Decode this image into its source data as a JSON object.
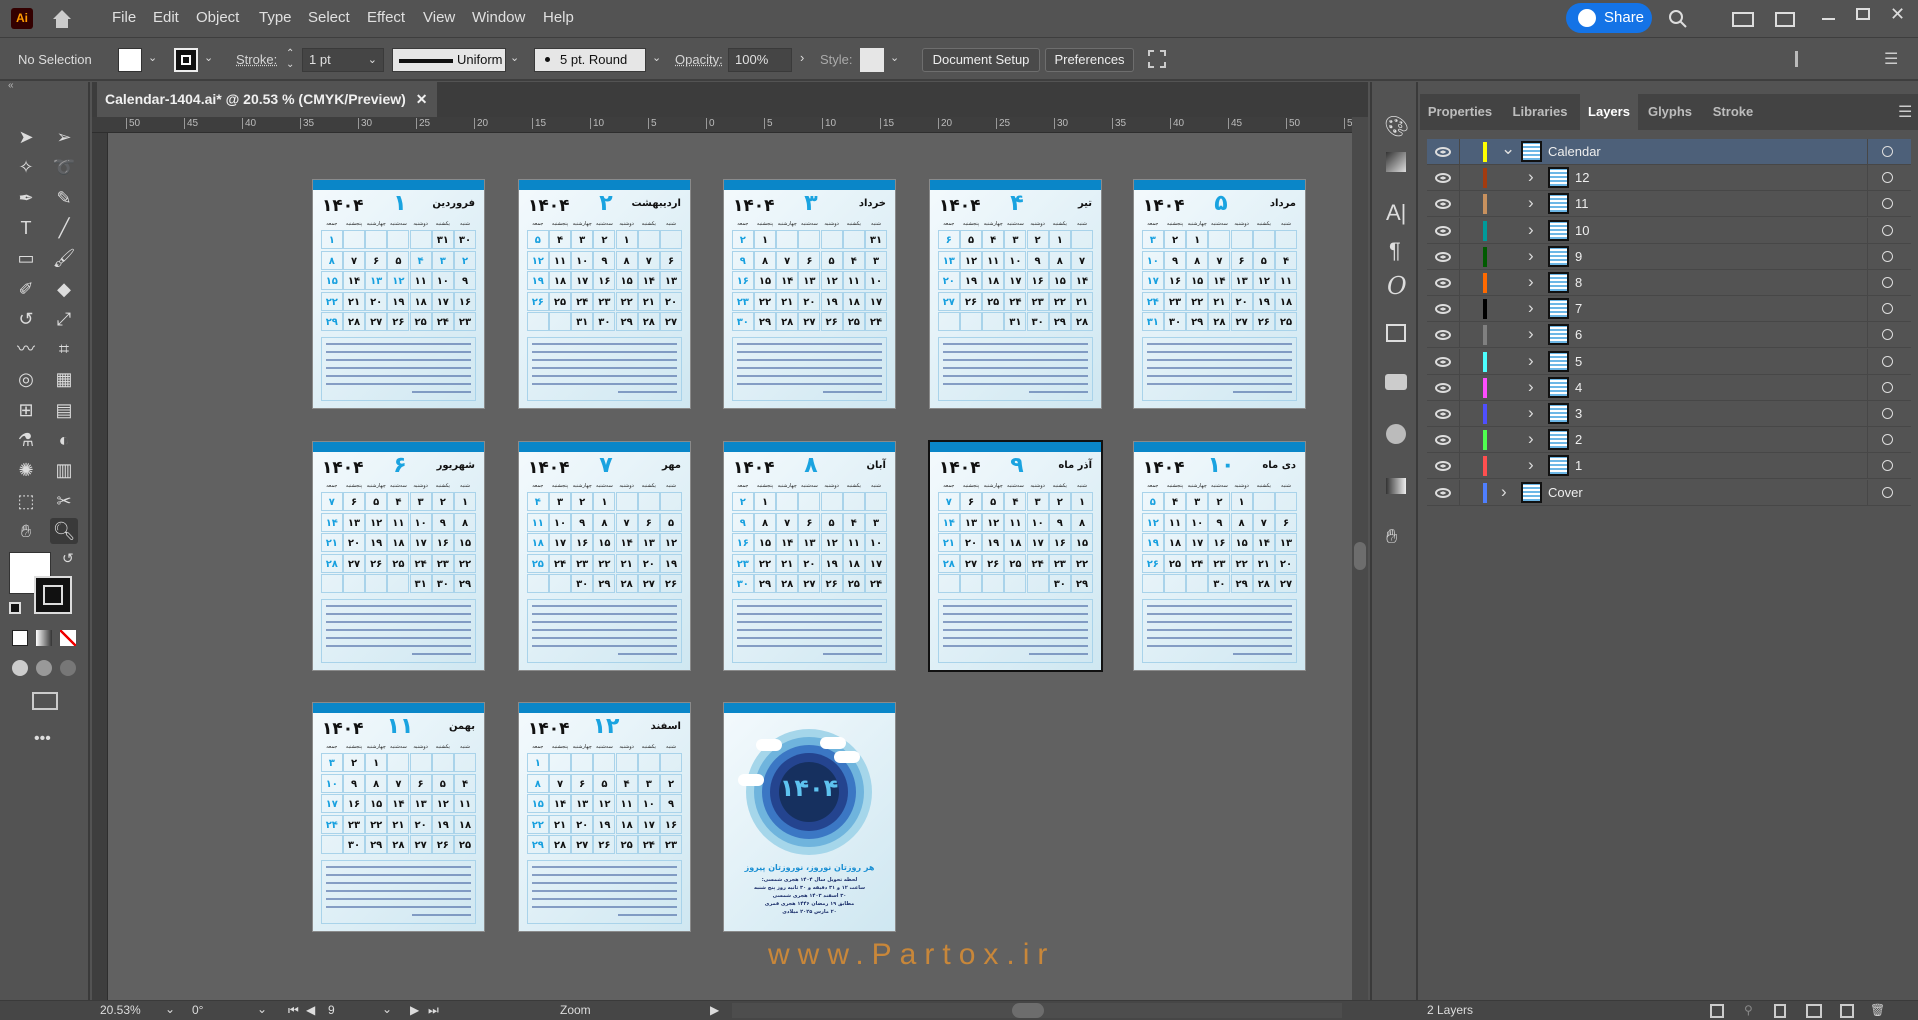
{
  "app": {
    "logo": "Ai",
    "home_icon": "home-icon"
  },
  "menu": [
    "File",
    "Edit",
    "Object",
    "Type",
    "Select",
    "Effect",
    "View",
    "Window",
    "Help"
  ],
  "share": {
    "label": "Share"
  },
  "control_bar": {
    "selection": "No Selection",
    "fill_color": "#ffffff",
    "stroke_label": "Stroke:",
    "stroke_weight": "1 pt",
    "stroke_profile": "Uniform",
    "brush": "5 pt. Round",
    "opacity_label": "Opacity:",
    "opacity": "100%",
    "style_label": "Style:",
    "document_setup": "Document Setup",
    "preferences": "Preferences"
  },
  "document_tab": {
    "title": "Calendar-1404.ai* @ 20.53 % (CMYK/Preview)",
    "close": "✕"
  },
  "ruler_ticks": [
    "50",
    "45",
    "40",
    "35",
    "30",
    "25",
    "20",
    "15",
    "10",
    "5",
    "0",
    "5",
    "10",
    "15",
    "20",
    "25",
    "30",
    "35",
    "40",
    "45",
    "50",
    "55"
  ],
  "tools": [
    "selection-icon",
    "direct-selection-icon",
    "magic-wand-icon",
    "lasso-icon",
    "pen-icon",
    "curvature-icon",
    "type-icon",
    "line-icon",
    "rectangle-icon",
    "paintbrush-icon",
    "shaper-icon",
    "eraser-icon",
    "rotate-icon",
    "scale-icon",
    "warp-icon",
    "free-transform-icon",
    "shape-builder-icon",
    "perspective-icon",
    "mesh-icon",
    "gradient-icon",
    "eyedropper-icon",
    "blend-icon",
    "symbol-sprayer-icon",
    "column-graph-icon",
    "artboard-icon",
    "slice-icon",
    "hand-icon",
    "zoom-icon"
  ],
  "calendar": {
    "year": "۱۴۰۴",
    "weekdays": [
      "شنبه",
      "یکشنبه",
      "دوشنبه",
      "سه‌شنبه",
      "چهارشنبه",
      "پنجشنبه",
      "جمعه"
    ],
    "first_weekday_of_year": 6,
    "months": [
      {
        "num": "۱",
        "name": "فروردین",
        "days": 31
      },
      {
        "num": "۲",
        "name": "اردیبهشت",
        "days": 31
      },
      {
        "num": "۳",
        "name": "خرداد",
        "days": 31
      },
      {
        "num": "۴",
        "name": "تیر",
        "days": 31
      },
      {
        "num": "۵",
        "name": "مرداد",
        "days": 31
      },
      {
        "num": "۶",
        "name": "شهریور",
        "days": 31
      },
      {
        "num": "۷",
        "name": "مهر",
        "days": 30
      },
      {
        "num": "۸",
        "name": "آبان",
        "days": 30
      },
      {
        "num": "۹",
        "name": "آذر ماه",
        "days": 30
      },
      {
        "num": "۱۰",
        "name": "دی ماه",
        "days": 30
      },
      {
        "num": "۱۱",
        "name": "بهمن",
        "days": 30
      },
      {
        "num": "۱۲",
        "name": "اسفند",
        "days": 29
      }
    ],
    "selected_month": 9,
    "cover": {
      "year": "۱۴۰۴",
      "slogan": "هر روزتان نوروز، نوروزتان پیروز",
      "lines": [
        "لحظه تحویل سال ۱۴۰۴ هجری شمسی:",
        "ساعت ۱۲ و ۳۱ دقیقه و ۳۰ ثانیه روز پنج شنبه",
        "۳۰ اسفند ۱۴۰۳ هجری شمسی",
        "مطابق ۱۹ رمضان ۱۴۴۶ هجری قمری",
        "۲۰ مارس ۲۰۲۵ میلادی"
      ]
    }
  },
  "watermark": "www.Partox.ir",
  "panel": {
    "tabs": [
      "Properties",
      "Libraries",
      "Layers",
      "Glyphs",
      "Stroke"
    ],
    "active_tab": "Layers",
    "layers": [
      {
        "name": "Calendar",
        "color": "#ffff00",
        "level": 0,
        "expanded": true,
        "selected": true
      },
      {
        "name": "12",
        "color": "#a33b0f",
        "level": 1
      },
      {
        "name": "11",
        "color": "#c8915e",
        "level": 1
      },
      {
        "name": "10",
        "color": "#009a9a",
        "level": 1
      },
      {
        "name": "9",
        "color": "#005a00",
        "level": 1
      },
      {
        "name": "8",
        "color": "#ff6a00",
        "level": 1
      },
      {
        "name": "7",
        "color": "#000000",
        "level": 1
      },
      {
        "name": "6",
        "color": "#808080",
        "level": 1
      },
      {
        "name": "5",
        "color": "#4dffff",
        "level": 1
      },
      {
        "name": "4",
        "color": "#ff4dff",
        "level": 1
      },
      {
        "name": "3",
        "color": "#4f4fff",
        "level": 1
      },
      {
        "name": "2",
        "color": "#4fff4f",
        "level": 1
      },
      {
        "name": "1",
        "color": "#ff4f4f",
        "level": 1
      },
      {
        "name": "Cover",
        "color": "#4f7fff",
        "level": 0,
        "expanded": false
      }
    ],
    "layer_count": "2 Layers"
  },
  "status_bar": {
    "zoom": "20.53%",
    "rotation": "0°",
    "artboard": "9",
    "mode": "Zoom"
  },
  "colors": {
    "accent": "#1473e6",
    "calendar_blue": "#0a86c8",
    "watermark": "#c8873a"
  }
}
